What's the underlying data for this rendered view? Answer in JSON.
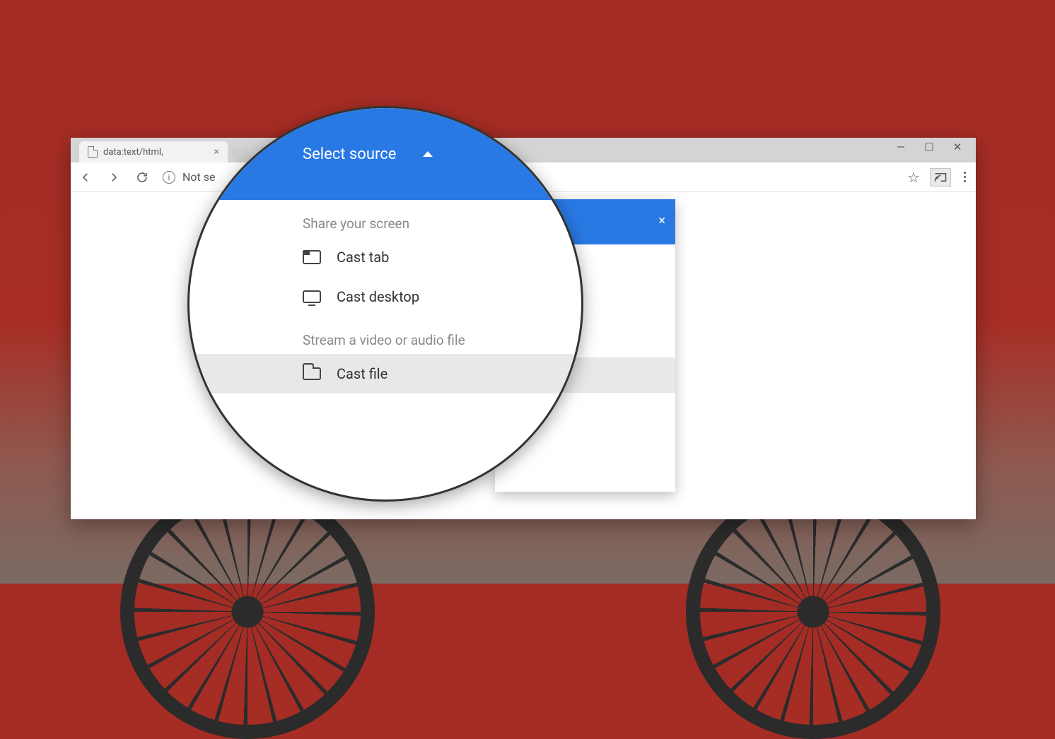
{
  "browser": {
    "tab_label": "data:text/html,",
    "address_text": "Not se",
    "window_buttons": {
      "min": "—",
      "max": "▢",
      "close": "✕"
    }
  },
  "cast_popup": {
    "close_label": "×"
  },
  "zoom_menu": {
    "header": "Select source",
    "section1": "Share your screen",
    "opt_tab": "Cast tab",
    "opt_desktop": "Cast desktop",
    "section2": "Stream a video or audio file",
    "opt_file": "Cast file"
  }
}
